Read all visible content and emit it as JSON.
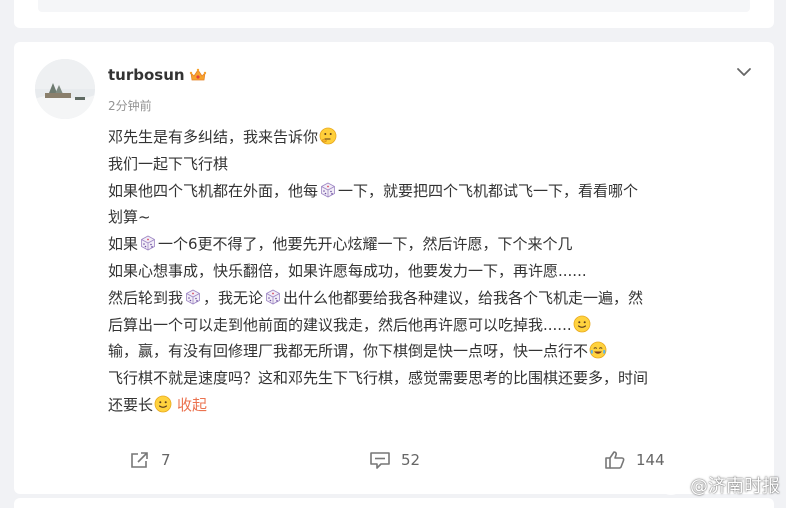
{
  "comment": {
    "username": "turbosun",
    "time": "2分钟前",
    "lines": [
      [
        "邓先生是有多纠结，我来告诉你",
        {
          "emoji": "thinking-face"
        }
      ],
      [
        "我们一起下飞行棋"
      ],
      [
        "如果他四个飞机都在外面，他每",
        {
          "emoji": "dice"
        },
        "一下，就要把四个飞机都试飞一下，看看哪个"
      ],
      [
        "划算~"
      ],
      [
        "如果",
        {
          "emoji": "dice"
        },
        "一个6更不得了，他要先开心炫耀一下，然后许愿，下个来个几"
      ],
      [
        "如果心想事成，快乐翻倍，如果许愿每成功，他要发力一下，再许愿......"
      ],
      [
        "然后轮到我",
        {
          "emoji": "dice"
        },
        "，我无论",
        {
          "emoji": "dice"
        },
        "出什么他都要给我各种建议，给我各个飞机走一遍，然"
      ],
      [
        "后算出一个可以走到他前面的建议我走，然后他再许愿可以吃掉我......",
        {
          "emoji": "slight-smile"
        }
      ],
      [
        "输，赢，有没有回修理厂我都无所谓，你下棋倒是快一点呀，快一点行不",
        {
          "emoji": "tears-of-joy"
        }
      ],
      [
        "飞行棋不就是速度吗？这和邓先生下飞行棋，感觉需要思考的比围棋还要多，时间"
      ],
      [
        "还要长",
        {
          "emoji": "slight-smile"
        },
        {
          "link": "收起"
        }
      ]
    ],
    "collapse_label": "收起"
  },
  "actions": {
    "share_count": "7",
    "comment_count": "52",
    "like_count": "144"
  },
  "watermark": {
    "text": "@济南时报"
  },
  "colors": {
    "link": "#eb7350",
    "text": "#333333",
    "muted": "#939393",
    "background": "#f1f2f5"
  }
}
